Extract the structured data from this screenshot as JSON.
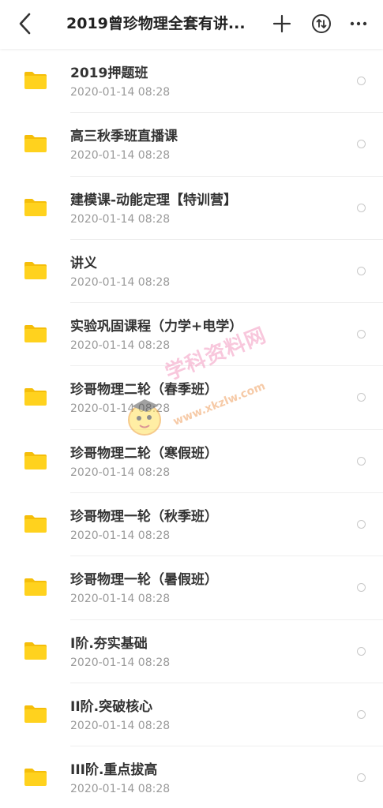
{
  "header": {
    "title": "2019曾珍物理全套有讲...",
    "back_icon": "chevron-left-icon",
    "add_icon": "plus-icon",
    "sort_icon": "sort-icon",
    "more_icon": "more-horizontal-icon"
  },
  "colors": {
    "folder": "#FFD21E",
    "folder_tab": "#F5BE0A",
    "name_text": "#333333",
    "date_text": "#9A9A9A"
  },
  "files": [
    {
      "name": "2019押题班",
      "date": "2020-01-14  08:28"
    },
    {
      "name": "高三秋季班直播课",
      "date": "2020-01-14  08:28"
    },
    {
      "name": "建模课-动能定理【特训营】",
      "date": "2020-01-14  08:28"
    },
    {
      "name": "讲义",
      "date": "2020-01-14  08:28"
    },
    {
      "name": "实验巩固课程（力学+电学）",
      "date": "2020-01-14  08:28"
    },
    {
      "name": "珍哥物理二轮（春季班）",
      "date": "2020-01-14  08:28"
    },
    {
      "name": "珍哥物理二轮（寒假班）",
      "date": "2020-01-14  08:28"
    },
    {
      "name": "珍哥物理一轮（秋季班）",
      "date": "2020-01-14  08:28"
    },
    {
      "name": "珍哥物理一轮（暑假班）",
      "date": "2020-01-14  08:28"
    },
    {
      "name": "I阶.夯实基础",
      "date": "2020-01-14  08:28"
    },
    {
      "name": "II阶.突破核心",
      "date": "2020-01-14  08:28"
    },
    {
      "name": "III阶.重点拔高",
      "date": "2020-01-14  08:28"
    }
  ],
  "watermark": {
    "text": "学科资料网",
    "url": "www.xkzlw.com"
  }
}
